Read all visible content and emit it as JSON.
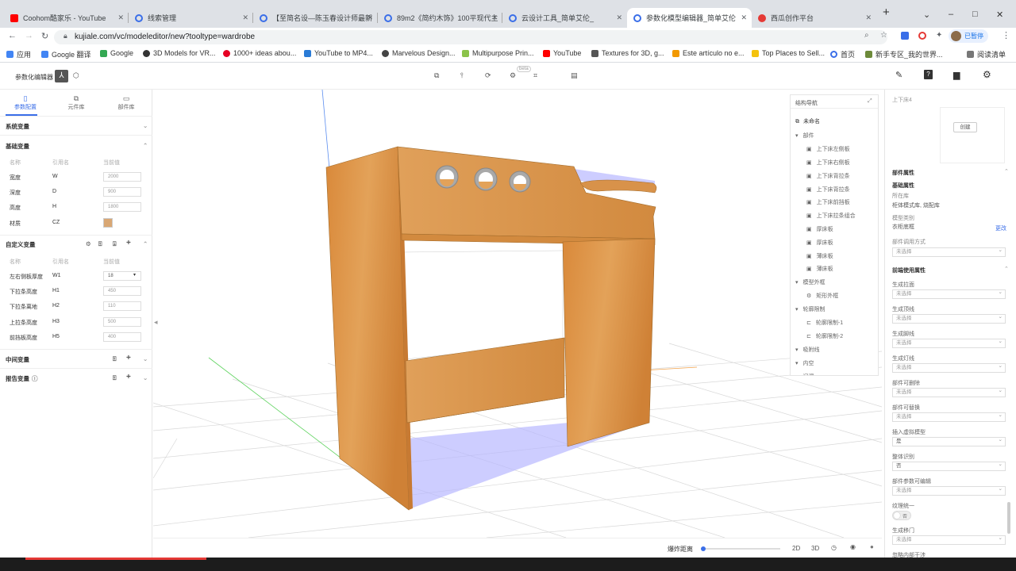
{
  "browser": {
    "tabs": [
      {
        "title": "Coohom酷家乐 - YouTube",
        "color": "#ff0000"
      },
      {
        "title": "线索管理",
        "color": "#3a6ee8"
      },
      {
        "title": "【至简名设—陈玉春设计师最新",
        "color": "#3a6ee8"
      },
      {
        "title": "89m2《简约木饰》100平现代主",
        "color": "#3a6ee8"
      },
      {
        "title": "云设计工具_简单艾伦_",
        "color": "#3a6ee8"
      },
      {
        "title": "参数化模型编辑器_简单艾伦",
        "color": "#3a6ee8"
      },
      {
        "title": "西瓜创作平台",
        "color": "#e53935"
      }
    ],
    "url": "kujiale.com/vc/modeleditor/new?tooltype=wardrobe",
    "profile_label": "已暂停",
    "bookmarks": [
      "应用",
      "Google 翻译",
      "Google",
      "3D Models for VR...",
      "1000+ ideas abou...",
      "YouTube to MP4...",
      "Marvelous Design...",
      "Multipurpose Prin...",
      "YouTube",
      "Textures for 3D, g...",
      "Este artículo no e...",
      "Top Places to Sell...",
      "首页",
      "新手专区_我的世界...",
      "阅读清单"
    ]
  },
  "app": {
    "title": "参数化编辑器",
    "beta_label": "beta"
  },
  "left": {
    "tabs": [
      "参数配置",
      "元件库",
      "部件库"
    ],
    "system_vars": "系统变量",
    "basic_vars": "基础变量",
    "headers": [
      "名称",
      "引用名",
      "当前值"
    ],
    "basic_rows": [
      {
        "name": "宽度",
        "ref": "W",
        "val": "2000"
      },
      {
        "name": "深度",
        "ref": "D",
        "val": "900"
      },
      {
        "name": "高度",
        "ref": "H",
        "val": "1800"
      },
      {
        "name": "材质",
        "ref": "CZ",
        "val": ""
      }
    ],
    "material_color": "#d9a774",
    "custom_vars": "自定义变量",
    "custom_rows": [
      {
        "name": "左右侧板厚度",
        "ref": "W1",
        "val": "18"
      },
      {
        "name": "下拉条高度",
        "ref": "H1",
        "val": "450"
      },
      {
        "name": "下拉条离地",
        "ref": "H2",
        "val": "110"
      },
      {
        "name": "上拉条高度",
        "ref": "H3",
        "val": "500"
      },
      {
        "name": "前挡板高度",
        "ref": "H5",
        "val": "400"
      }
    ],
    "middle_vars": "中间变量",
    "report_vars": "报告变量"
  },
  "nav": {
    "title": "结构导航",
    "root": "未命名",
    "groups": [
      {
        "label": "部件",
        "items": [
          "上下床左侧板",
          "上下床右侧板",
          "上下床背拉条",
          "上下床背拉条",
          "上下床前挡板",
          "上下床拉条组合",
          "厚床板",
          "厚床板",
          "薄床板",
          "薄床板"
        ]
      },
      {
        "label": "模型外框",
        "items": [
          "矩形外框"
        ]
      },
      {
        "label": "轮廓限制",
        "items": [
          "轮廓限制-1",
          "轮廓限制-2"
        ]
      },
      {
        "label": "吸附线",
        "items": []
      },
      {
        "label": "内空",
        "items": []
      },
      {
        "label": "门洞",
        "items": []
      }
    ]
  },
  "right": {
    "header": "上下床4",
    "create_label": "创建",
    "part_props": "部件属性",
    "basic_props": "基础属性",
    "lib_label": "所在库",
    "lib_value": "柜体模式库, 烧配库",
    "model_type_label": "模型类别",
    "model_type_value": "衣柜底框",
    "change_label": "更改",
    "call_label": "部件调用方式",
    "call_value": "未选择",
    "frontend_props": "前端使用属性",
    "fields": [
      {
        "label": "生成拉面",
        "value": "未选择"
      },
      {
        "label": "生成顶线",
        "value": "未选择"
      },
      {
        "label": "生成脚线",
        "value": "未选择"
      },
      {
        "label": "生成灯线",
        "value": "未选择"
      },
      {
        "label": "部件可删除",
        "value": "未选择"
      },
      {
        "label": "部件可替换",
        "value": "未选择"
      },
      {
        "label": "插入虚拟模型",
        "value": "是"
      },
      {
        "label": "整体识别",
        "value": "否"
      },
      {
        "label": "部件参数可编辑",
        "value": "未选择"
      }
    ],
    "texture_label": "纹理统一",
    "toggle_value": "否",
    "door_label": "生成移门",
    "door_value": "未选择",
    "last_label": "忽略内部干涉"
  },
  "bottom": {
    "label": "爆炸距离",
    "view2d": "2D",
    "view3d": "3D"
  }
}
